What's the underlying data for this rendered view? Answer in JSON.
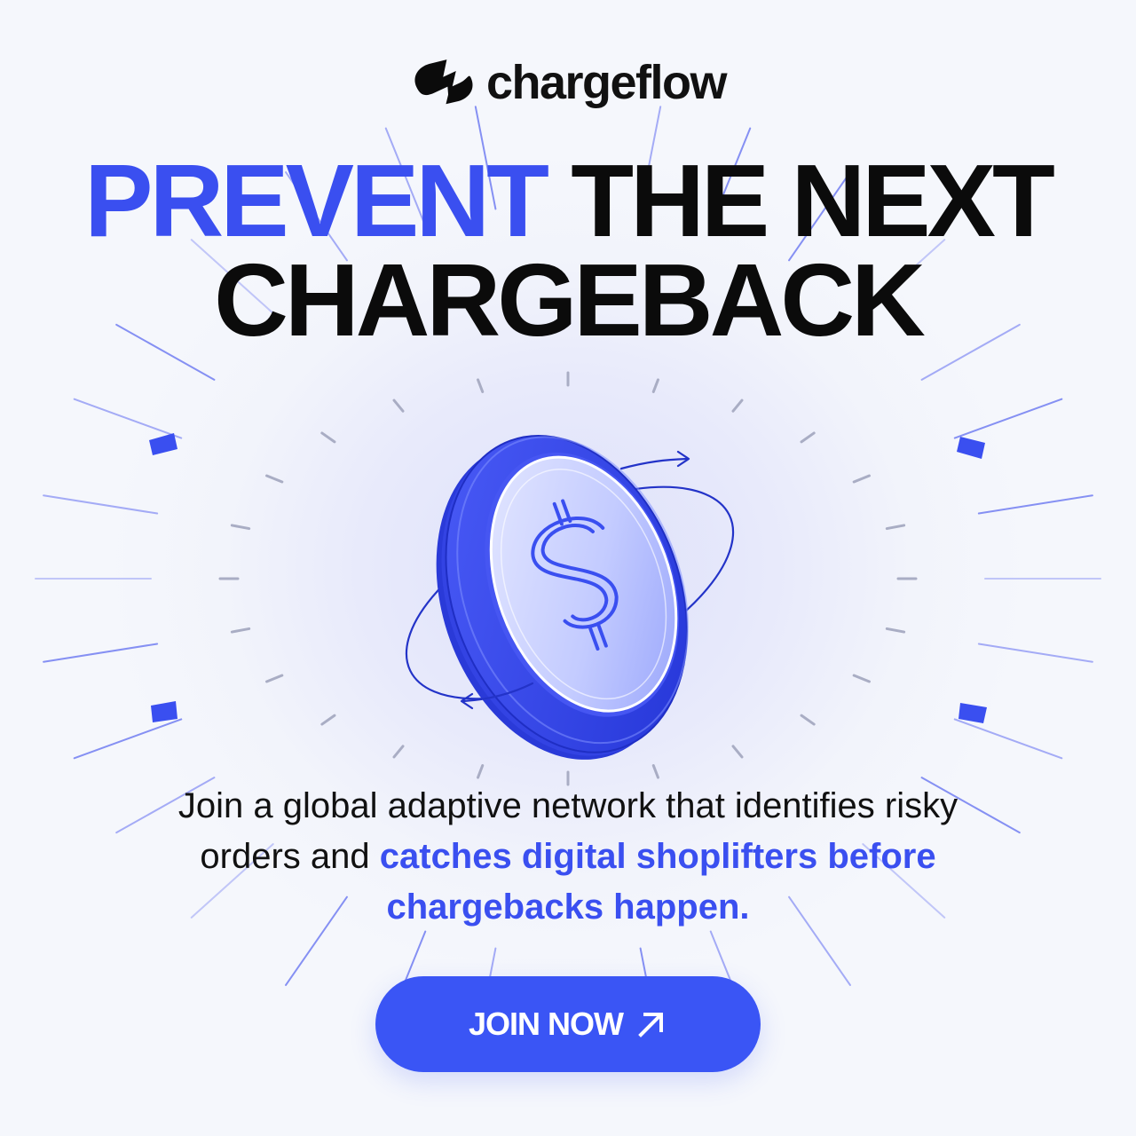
{
  "brand": {
    "name": "chargeflow",
    "logo_icon": "chargeflow-logo-icon"
  },
  "headline": {
    "accent": "PREVENT",
    "rest": " THE NEXT CHARGEBACK"
  },
  "description": {
    "plain": "Join a global adaptive network that identifies risky orders and ",
    "accent": "catches digital shoplifters before chargebacks happen."
  },
  "cta": {
    "label": "JOIN NOW",
    "icon": "arrow-up-right-icon"
  },
  "illustration": {
    "icon": "dollar-coin-icon"
  },
  "colors": {
    "accent": "#3a4ff0",
    "button": "#3a55f5",
    "text": "#111111",
    "background": "#f3f5fb"
  }
}
